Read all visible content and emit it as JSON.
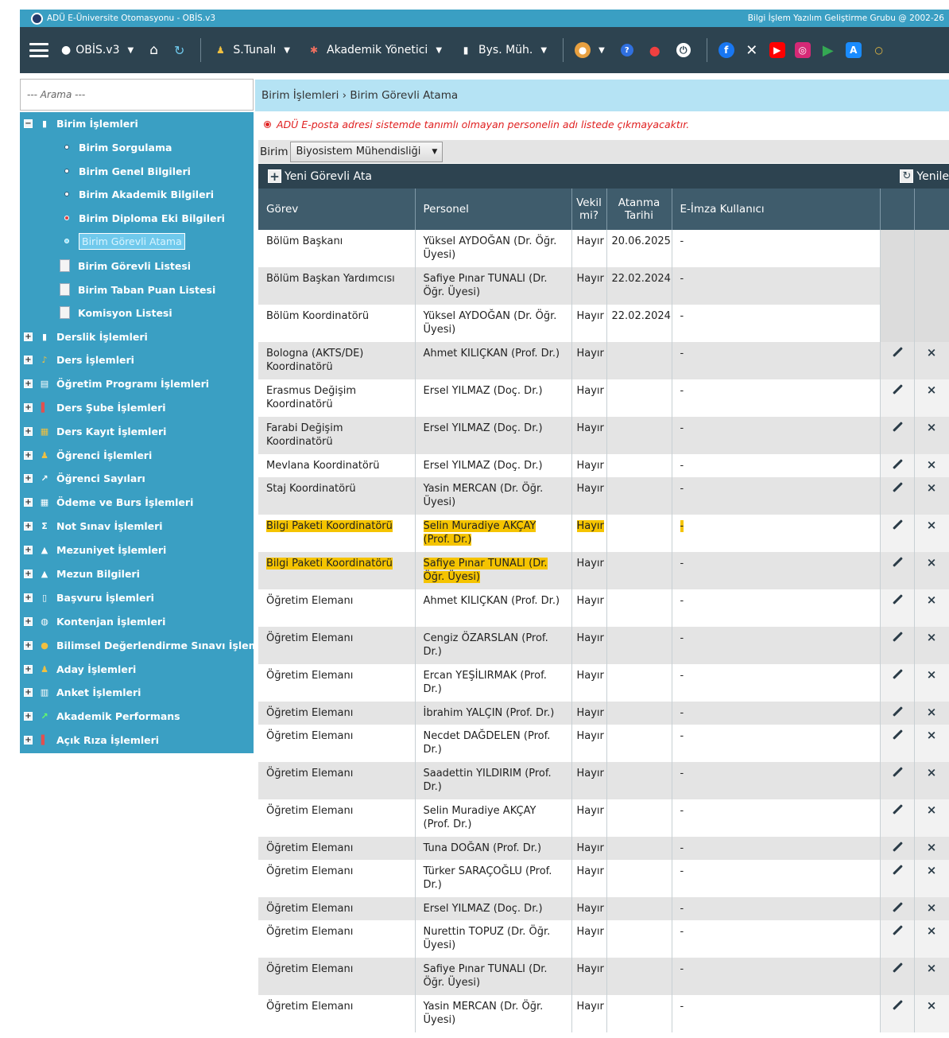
{
  "titlebar": {
    "left": "ADÜ E-Üniversite Otomasyonu - OBİS.v3",
    "right": "Bilgi İşlem Yazılım Geliştirme Grubu @ 2002-26"
  },
  "toolbar": {
    "app": "OBİS.v3",
    "user": "S.Tunalı",
    "role": "Akademik Yönetici",
    "unit": "Bys. Müh."
  },
  "search": {
    "placeholder": "--- Arama ---"
  },
  "breadcrumb": {
    "parent": "Birim İşlemleri",
    "sep": " › ",
    "current": "Birim Görevli Atama"
  },
  "warning": "ADÜ E-posta adresi sistemde tanımlı olmayan personelin adı listede çıkmayacaktır.",
  "birim": {
    "label": "Birim",
    "value": "Biyosistem Mühendisliği"
  },
  "actions": {
    "new": "Yeni Görevli Ata",
    "refresh": "Yenile"
  },
  "sidebar": {
    "top_open": "Birim İşlemleri",
    "sub_items": [
      "Birim Sorgulama",
      "Birim Genel Bilgileri",
      "Birim Akademik Bilgileri",
      "Birim Diploma Eki Bilgileri",
      "Birim Görevli Atama",
      "Birim Görevli Listesi",
      "Birim Taban Puan Listesi",
      "Komisyon Listesi"
    ],
    "groups": [
      "Derslik İşlemleri",
      "Ders İşlemleri",
      "Öğretim Programı İşlemleri",
      "Ders Şube İşlemleri",
      "Ders Kayıt İşlemleri",
      "Öğrenci İşlemleri",
      "Öğrenci Sayıları",
      "Ödeme ve Burs İşlemleri",
      "Not Sınav İşlemleri",
      "Mezuniyet İşlemleri",
      "Mezun Bilgileri",
      "Başvuru İşlemleri",
      "Kontenjan İşlemleri",
      "Bilimsel Değerlendirme Sınavı İşlemleri",
      "Aday İşlemleri",
      "Anket İşlemleri",
      "Akademik Performans",
      "Açık Rıza İşlemleri"
    ]
  },
  "table": {
    "headers": {
      "gorev": "Görev",
      "personel": "Personel",
      "vekil": "Vekil mi?",
      "atanma": "Atanma Tarihi",
      "eimza": "E-İmza Kullanıcı"
    },
    "rows": [
      {
        "gorev": "Bölüm Başkanı",
        "personel": "Yüksel AYDOĞAN (Dr. Öğr. Üyesi)",
        "vekil": "Hayır",
        "tarih": "20.06.2025",
        "eimza": "-",
        "actions": false
      },
      {
        "gorev": "Bölüm Başkan Yardımcısı",
        "personel": "Safiye Pınar TUNALI (Dr. Öğr. Üyesi)",
        "vekil": "Hayır",
        "tarih": "22.02.2024",
        "eimza": "-",
        "actions": false
      },
      {
        "gorev": "Bölüm Koordinatörü",
        "personel": "Yüksel AYDOĞAN (Dr. Öğr. Üyesi)",
        "vekil": "Hayır",
        "tarih": "22.02.2024",
        "eimza": "-",
        "actions": false
      },
      {
        "gorev": "Bologna (AKTS/DE) Koordinatörü",
        "personel": "Ahmet KILIÇKAN (Prof. Dr.)",
        "vekil": "Hayır",
        "tarih": "",
        "eimza": "-",
        "actions": true
      },
      {
        "gorev": "Erasmus Değişim Koordinatörü",
        "personel": "Ersel YILMAZ (Doç. Dr.)",
        "vekil": "Hayır",
        "tarih": "",
        "eimza": "-",
        "actions": true
      },
      {
        "gorev": "Farabi Değişim Koordinatörü",
        "personel": "Ersel YILMAZ (Doç. Dr.)",
        "vekil": "Hayır",
        "tarih": "",
        "eimza": "-",
        "actions": true
      },
      {
        "gorev": "Mevlana Koordinatörü",
        "personel": "Ersel YILMAZ (Doç. Dr.)",
        "vekil": "Hayır",
        "tarih": "",
        "eimza": "-",
        "actions": true
      },
      {
        "gorev": "Staj Koordinatörü",
        "personel": "Yasin MERCAN (Dr. Öğr. Üyesi)",
        "vekil": "Hayır",
        "tarih": "",
        "eimza": "-",
        "actions": true
      },
      {
        "gorev": "Bilgi Paketi Koordinatörü",
        "personel": "Selin Muradiye AKÇAY (Prof. Dr.)",
        "vekil": "Hayır",
        "tarih": "",
        "eimza": "-",
        "actions": true,
        "highlight": "all"
      },
      {
        "gorev": "Bilgi Paketi Koordinatörü",
        "personel": "Safiye Pınar TUNALI (Dr. Öğr. Üyesi)",
        "vekil": "Hayır",
        "tarih": "",
        "eimza": "-",
        "actions": true,
        "highlight": "partial"
      },
      {
        "gorev": "Öğretim Elemanı",
        "personel": "Ahmet KILIÇKAN (Prof. Dr.)",
        "vekil": "Hayır",
        "tarih": "",
        "eimza": "-",
        "actions": true
      },
      {
        "gorev": "Öğretim Elemanı",
        "personel": "Cengiz ÖZARSLAN (Prof. Dr.)",
        "vekil": "Hayır",
        "tarih": "",
        "eimza": "-",
        "actions": true
      },
      {
        "gorev": "Öğretim Elemanı",
        "personel": "Ercan YEŞİLIRMAK (Prof. Dr.)",
        "vekil": "Hayır",
        "tarih": "",
        "eimza": "-",
        "actions": true
      },
      {
        "gorev": "Öğretim Elemanı",
        "personel": "İbrahim YALÇIN (Prof. Dr.)",
        "vekil": "Hayır",
        "tarih": "",
        "eimza": "-",
        "actions": true
      },
      {
        "gorev": "Öğretim Elemanı",
        "personel": "Necdet DAĞDELEN (Prof. Dr.)",
        "vekil": "Hayır",
        "tarih": "",
        "eimza": "-",
        "actions": true
      },
      {
        "gorev": "Öğretim Elemanı",
        "personel": "Saadettin YILDIRIM (Prof. Dr.)",
        "vekil": "Hayır",
        "tarih": "",
        "eimza": "-",
        "actions": true
      },
      {
        "gorev": "Öğretim Elemanı",
        "personel": "Selin Muradiye AKÇAY (Prof. Dr.)",
        "vekil": "Hayır",
        "tarih": "",
        "eimza": "-",
        "actions": true
      },
      {
        "gorev": "Öğretim Elemanı",
        "personel": "Tuna DOĞAN (Prof. Dr.)",
        "vekil": "Hayır",
        "tarih": "",
        "eimza": "-",
        "actions": true
      },
      {
        "gorev": "Öğretim Elemanı",
        "personel": "Türker SARAÇOĞLU (Prof. Dr.)",
        "vekil": "Hayır",
        "tarih": "",
        "eimza": "-",
        "actions": true
      },
      {
        "gorev": "Öğretim Elemanı",
        "personel": "Ersel YILMAZ (Doç. Dr.)",
        "vekil": "Hayır",
        "tarih": "",
        "eimza": "-",
        "actions": true
      },
      {
        "gorev": "Öğretim Elemanı",
        "personel": "Nurettin TOPUZ (Dr. Öğr. Üyesi)",
        "vekil": "Hayır",
        "tarih": "",
        "eimza": "-",
        "actions": true
      },
      {
        "gorev": "Öğretim Elemanı",
        "personel": "Safiye Pınar TUNALI (Dr. Öğr. Üyesi)",
        "vekil": "Hayır",
        "tarih": "",
        "eimza": "-",
        "actions": true
      },
      {
        "gorev": "Öğretim Elemanı",
        "personel": "Yasin MERCAN (Dr. Öğr. Üyesi)",
        "vekil": "Hayır",
        "tarih": "",
        "eimza": "-",
        "actions": true
      }
    ]
  },
  "colors": {
    "titlebar": "#3a9fc3",
    "toolbar": "#2d4350",
    "sidebar": "#3a9fc3",
    "breadcrumb": "#b5e3f4",
    "highlight": "#f5c400",
    "warning": "#e02020"
  }
}
